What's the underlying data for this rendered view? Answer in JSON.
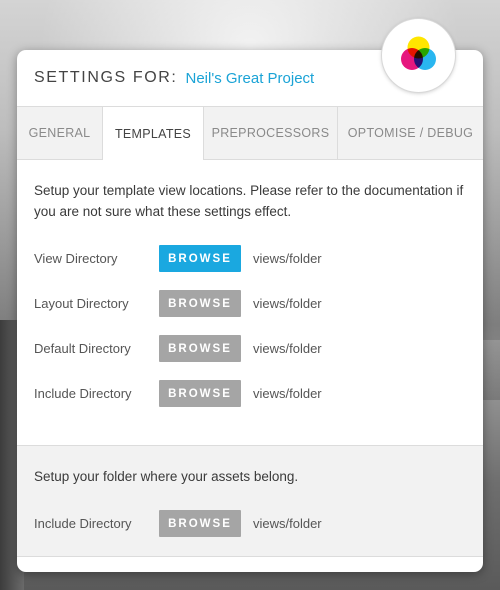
{
  "header": {
    "label": "SETTINGS FOR:",
    "project_name": "Neil's Great Project"
  },
  "tabs": [
    {
      "label": "GENERAL",
      "active": false
    },
    {
      "label": "TEMPLATES",
      "active": true
    },
    {
      "label": "PREPROCESSORS",
      "active": false
    },
    {
      "label": "OPTOMISE / DEBUG",
      "active": false
    }
  ],
  "templates_section": {
    "intro": "Setup your template view locations. Please refer to the documentation if you are not sure what these settings effect.",
    "rows": [
      {
        "label": "View Directory",
        "button": "BROWSE",
        "path": "views/folder"
      },
      {
        "label": "Layout Directory",
        "button": "BROWSE",
        "path": "views/folder"
      },
      {
        "label": "Default Directory",
        "button": "BROWSE",
        "path": "views/folder"
      },
      {
        "label": "Include Directory",
        "button": "BROWSE",
        "path": "views/folder"
      }
    ]
  },
  "assets_section": {
    "intro": "Setup your folder where your assets belong.",
    "rows": [
      {
        "label": "Include Directory",
        "button": "BROWSE",
        "path": "views/folder"
      }
    ]
  },
  "colors": {
    "accent": "#1aa8e0",
    "button_default": "#a5a5a5",
    "logo_cyan": "#29b6f0",
    "logo_magenta": "#e6177e",
    "logo_yellow": "#ffe600"
  },
  "icons": {
    "logo": "cmy-circles-logo"
  }
}
